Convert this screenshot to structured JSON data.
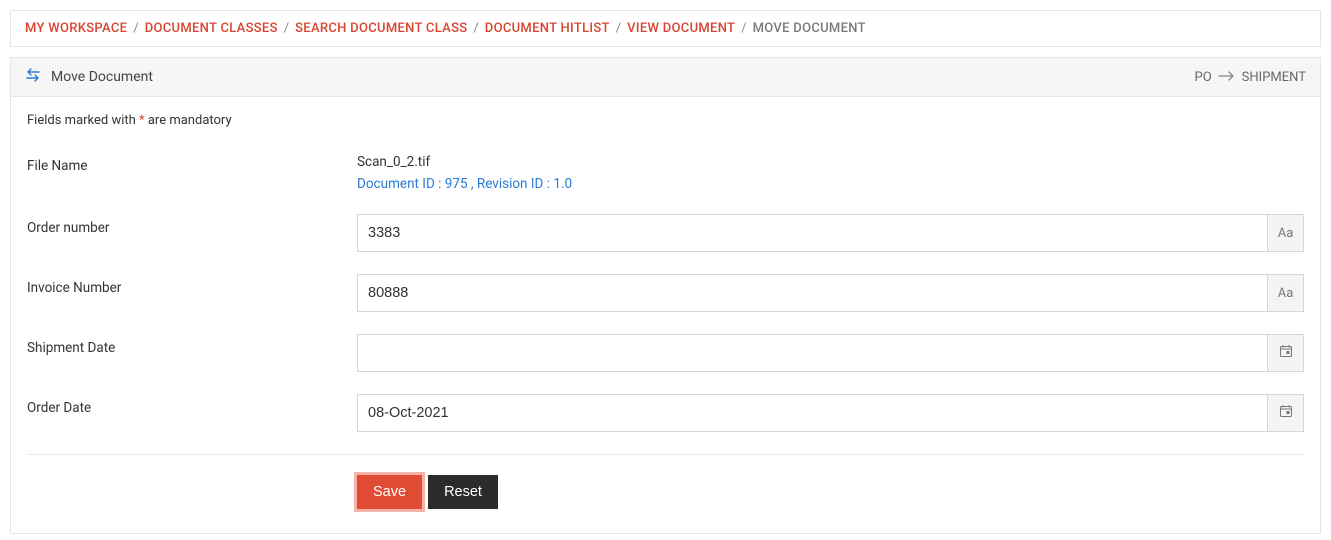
{
  "breadcrumb": {
    "items": [
      {
        "label": "MY WORKSPACE"
      },
      {
        "label": "DOCUMENT CLASSES"
      },
      {
        "label": "SEARCH DOCUMENT CLASS"
      },
      {
        "label": "DOCUMENT HITLIST"
      },
      {
        "label": "VIEW DOCUMENT"
      }
    ],
    "current": "MOVE DOCUMENT"
  },
  "panel": {
    "title": "Move Document",
    "path_from": "PO",
    "path_to": "SHIPMENT"
  },
  "hint": {
    "prefix": "Fields marked with ",
    "star": "*",
    "suffix": " are mandatory"
  },
  "file": {
    "label": "File Name",
    "name": "Scan_0_2.tif",
    "doc_link": "Document ID : 975 , Revision ID : 1.0"
  },
  "fields": {
    "order_number": {
      "label": "Order number",
      "value": "3383"
    },
    "invoice_number": {
      "label": "Invoice Number",
      "value": "80888"
    },
    "shipment_date": {
      "label": "Shipment Date",
      "value": ""
    },
    "order_date": {
      "label": "Order Date",
      "value": "08-Oct-2021"
    }
  },
  "addons": {
    "text_case": "Aa"
  },
  "buttons": {
    "save": "Save",
    "reset": "Reset"
  }
}
